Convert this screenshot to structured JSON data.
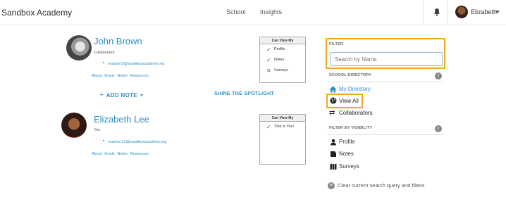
{
  "header": {
    "brand": "Sandbox Academy",
    "nav": [
      "School",
      "Insights"
    ],
    "user_name": "Elizabeth"
  },
  "people": [
    {
      "name": "John Brown",
      "role": "Collaborator",
      "email": "teacher2@sandboxacademy.org",
      "links": [
        "About",
        "Goals",
        "Notes",
        "Resources"
      ],
      "can_view": {
        "title": "Can View My",
        "items": [
          {
            "label": "Profile",
            "allowed": true
          },
          {
            "label": "Notes",
            "allowed": true
          },
          {
            "label": "Surveys",
            "allowed": false
          }
        ]
      }
    },
    {
      "name": "Elizabeth Lee",
      "role": "You",
      "email": "teacher13@sandboxacademy.org",
      "links": [
        "About",
        "Goals",
        "Notes",
        "Resources"
      ],
      "can_view": {
        "title": "Can View My",
        "items": [
          {
            "label": "This is You!",
            "allowed": true
          }
        ]
      }
    }
  ],
  "actions": {
    "add_note": "ADD NOTE",
    "spotlight": "SHINE THE SPOTLIGHT"
  },
  "sidebar": {
    "filter_title": "FILTER",
    "search_placeholder": "Search by Name",
    "directory_title": "SCHOOL DIRECTORY",
    "directory_items": [
      "My Directory",
      "View All",
      "Collaborators"
    ],
    "visibility_title": "FILTER BY VISIBILITY",
    "visibility_items": [
      "Profile",
      "Notes",
      "Surveys"
    ],
    "clear_label": "Clear current search query and filters"
  },
  "colors": {
    "link": "#2c8fca",
    "highlight": "#f5a623"
  }
}
